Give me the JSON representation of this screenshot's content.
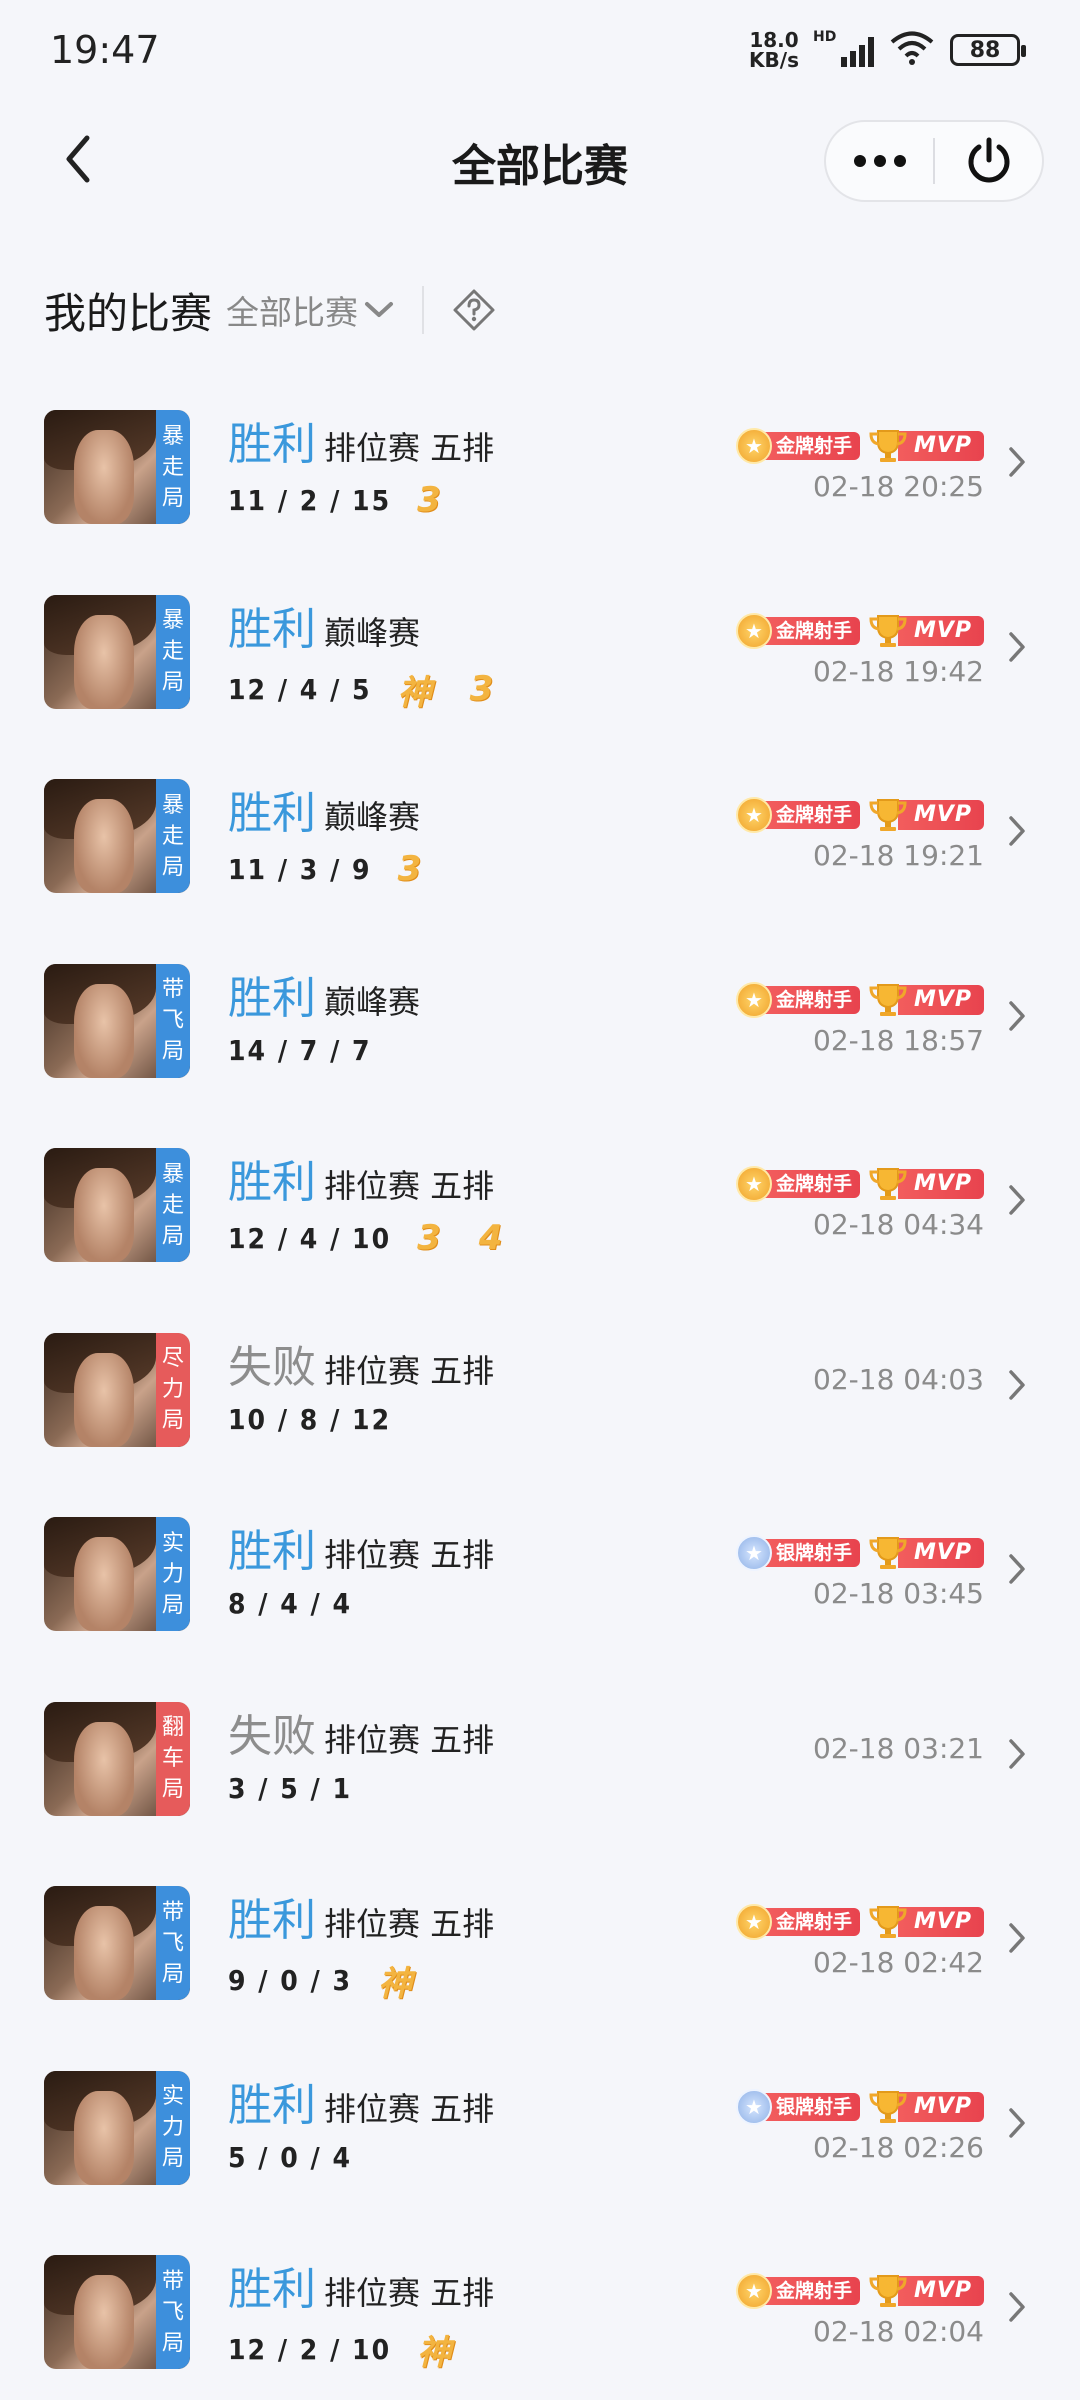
{
  "status_bar": {
    "time": "19:47",
    "net_speed_value": "18.0",
    "net_speed_unit": "KB/s",
    "network_label": "HD",
    "battery": "88"
  },
  "header": {
    "title": "全部比赛",
    "back_icon": "chevron-left-icon",
    "more_icon": "more-dots-icon",
    "power_icon": "power-icon"
  },
  "filter": {
    "title": "我的比赛",
    "select_value": "全部比赛",
    "help_icon": "diamond-question-icon"
  },
  "colors": {
    "win": "#3a98dc",
    "lose": "#8d8d8d",
    "tag_blue": "#3d8fdc",
    "tag_red": "#e65b5b",
    "badge_red": "#e8434e",
    "streak": "#f3b440"
  },
  "matches": [
    {
      "tag": [
        "暴",
        "走",
        "局"
      ],
      "tag_color": "blue",
      "result": "胜利",
      "win": true,
      "mode": "排位赛 五排",
      "kda": "11 / 2 / 15",
      "streaks": [
        "3"
      ],
      "medal": "金牌射手",
      "medal_type": "gold",
      "mvp": "MVP",
      "time": "02-18 20:25"
    },
    {
      "tag": [
        "暴",
        "走",
        "局"
      ],
      "tag_color": "blue",
      "result": "胜利",
      "win": true,
      "mode": "巅峰赛",
      "kda": "12 / 4 / 5",
      "streaks": [
        "神",
        "3"
      ],
      "medal": "金牌射手",
      "medal_type": "gold",
      "mvp": "MVP",
      "time": "02-18 19:42"
    },
    {
      "tag": [
        "暴",
        "走",
        "局"
      ],
      "tag_color": "blue",
      "result": "胜利",
      "win": true,
      "mode": "巅峰赛",
      "kda": "11 / 3 / 9",
      "streaks": [
        "3"
      ],
      "medal": "金牌射手",
      "medal_type": "gold",
      "mvp": "MVP",
      "time": "02-18 19:21"
    },
    {
      "tag": [
        "带",
        "飞",
        "局"
      ],
      "tag_color": "blue",
      "result": "胜利",
      "win": true,
      "mode": "巅峰赛",
      "kda": "14 / 7 / 7",
      "streaks": [],
      "medal": "金牌射手",
      "medal_type": "gold",
      "mvp": "MVP",
      "time": "02-18 18:57"
    },
    {
      "tag": [
        "暴",
        "走",
        "局"
      ],
      "tag_color": "blue",
      "result": "胜利",
      "win": true,
      "mode": "排位赛 五排",
      "kda": "12 / 4 / 10",
      "streaks": [
        "3",
        "4"
      ],
      "medal": "金牌射手",
      "medal_type": "gold",
      "mvp": "MVP",
      "time": "02-18 04:34"
    },
    {
      "tag": [
        "尽",
        "力",
        "局"
      ],
      "tag_color": "red",
      "result": "失败",
      "win": false,
      "mode": "排位赛 五排",
      "kda": "10 / 8 / 12",
      "streaks": [],
      "medal": "",
      "medal_type": "",
      "mvp": "",
      "time": "02-18 04:03"
    },
    {
      "tag": [
        "实",
        "力",
        "局"
      ],
      "tag_color": "blue",
      "result": "胜利",
      "win": true,
      "mode": "排位赛 五排",
      "kda": "8 / 4 / 4",
      "streaks": [],
      "medal": "银牌射手",
      "medal_type": "silver",
      "mvp": "MVP",
      "time": "02-18 03:45"
    },
    {
      "tag": [
        "翻",
        "车",
        "局"
      ],
      "tag_color": "red",
      "result": "失败",
      "win": false,
      "mode": "排位赛 五排",
      "kda": "3 / 5 / 1",
      "streaks": [],
      "medal": "",
      "medal_type": "",
      "mvp": "",
      "time": "02-18 03:21"
    },
    {
      "tag": [
        "带",
        "飞",
        "局"
      ],
      "tag_color": "blue",
      "result": "胜利",
      "win": true,
      "mode": "排位赛 五排",
      "kda": "9 / 0 / 3",
      "streaks": [
        "神"
      ],
      "medal": "金牌射手",
      "medal_type": "gold",
      "mvp": "MVP",
      "time": "02-18 02:42"
    },
    {
      "tag": [
        "实",
        "力",
        "局"
      ],
      "tag_color": "blue",
      "result": "胜利",
      "win": true,
      "mode": "排位赛 五排",
      "kda": "5 / 0 / 4",
      "streaks": [],
      "medal": "银牌射手",
      "medal_type": "silver",
      "mvp": "MVP",
      "time": "02-18 02:26"
    },
    {
      "tag": [
        "带",
        "飞",
        "局"
      ],
      "tag_color": "blue",
      "result": "胜利",
      "win": true,
      "mode": "排位赛 五排",
      "kda": "12 / 2 / 10",
      "streaks": [
        "神"
      ],
      "medal": "金牌射手",
      "medal_type": "gold",
      "mvp": "MVP",
      "time": "02-18 02:04"
    }
  ]
}
